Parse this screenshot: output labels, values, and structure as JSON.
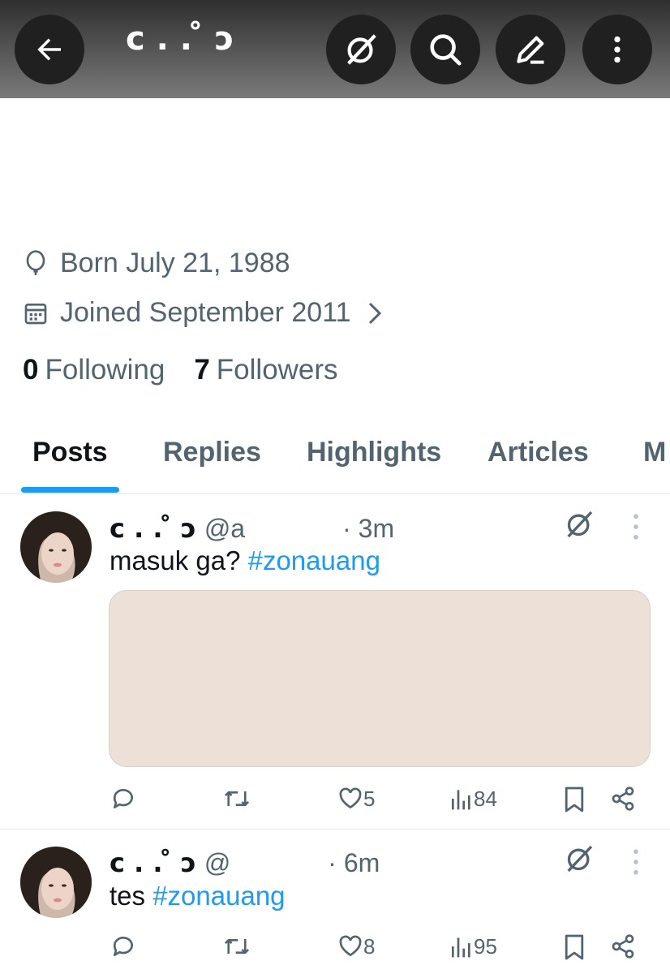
{
  "header": {
    "display_name": "ϲ . . ̊ ͻ",
    "back_icon": "back-arrow-icon",
    "buttons": [
      "grok-icon",
      "search-icon",
      "edit-icon",
      "more-icon"
    ]
  },
  "profile": {
    "born": "Born July 21, 1988",
    "joined": "Joined September 2011",
    "following_count": "0",
    "following_label": "Following",
    "followers_count": "7",
    "followers_label": "Followers"
  },
  "tabs": [
    "Posts",
    "Replies",
    "Highlights",
    "Articles",
    "M"
  ],
  "posts": [
    {
      "name": "ϲ . . ̊ ͻ",
      "handle": "@a",
      "time": "· 3m",
      "text": "masuk ga? ",
      "hashtag": "#zonauang",
      "likes": "5",
      "views": "84"
    },
    {
      "name": "ϲ . . ̊ ͻ",
      "handle": "@",
      "time": "· 6m",
      "text": "tes ",
      "hashtag": "#zonauang",
      "likes": "8",
      "views": "95"
    }
  ],
  "colors": {
    "accent": "#1d9bf0",
    "secondary_text": "#536471",
    "header_bg": "#2f2f2f"
  }
}
